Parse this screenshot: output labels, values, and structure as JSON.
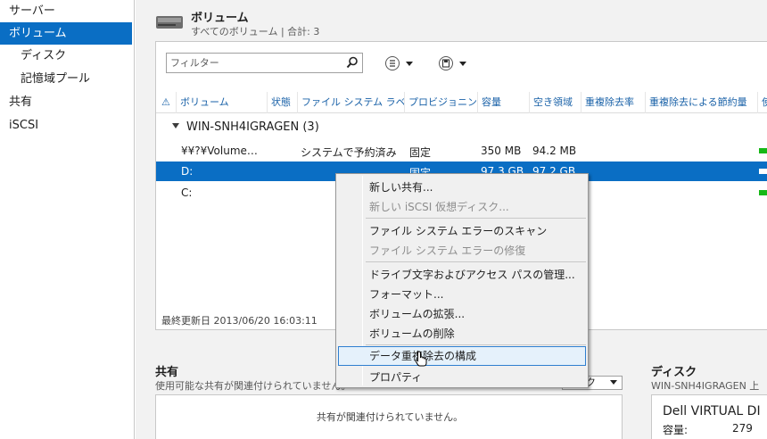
{
  "sidebar": {
    "items": [
      {
        "label": "サーバー"
      },
      {
        "label": "ボリューム"
      },
      {
        "label": "ディスク"
      },
      {
        "label": "記憶域プール"
      },
      {
        "label": "共有"
      },
      {
        "label": "iSCSI"
      }
    ]
  },
  "volumes": {
    "title": "ボリューム",
    "subtitle": "すべてのボリューム | 合計: 3",
    "filter_placeholder": "フィルター",
    "columns": [
      "ボリューム",
      "状態",
      "ファイル システム ラベル",
      "プロビジョニング",
      "容量",
      "空き領域",
      "重複除去率",
      "重複除去による節約量",
      "使"
    ],
    "group": "WIN-SNH4IGRAGEN (3)",
    "rows": [
      {
        "volume": "¥¥?¥Volume…",
        "label": "システムで予約済み",
        "provisioning": "固定",
        "capacity": "350 MB",
        "free": "94.2 MB"
      },
      {
        "volume": "D:",
        "label": "",
        "provisioning": "固定",
        "capacity": "97.3 GB",
        "free": "97.2 GB"
      },
      {
        "volume": "C:",
        "label": "",
        "provisioning": "",
        "capacity": "",
        "free": ""
      }
    ],
    "last_updated": "最終更新日 2013/06/20 16:03:11"
  },
  "shares": {
    "title": "共有",
    "subtitle": "使用可能な共有が関連付けられていません。",
    "tasks_label": "タスク",
    "empty_text": "共有が関連付けられていません。"
  },
  "disk": {
    "title": "ディスク",
    "subtitle": "WIN-SNH4IGRAGEN 上",
    "name": "Dell VIRTUAL DI",
    "capacity_label": "容量:",
    "capacity_value": "279"
  },
  "context_menu": {
    "items": [
      {
        "label": "新しい共有...",
        "disabled": false
      },
      {
        "label": "新しい iSCSI 仮想ディスク...",
        "disabled": true
      },
      {
        "label": "ファイル システム エラーのスキャン",
        "disabled": false
      },
      {
        "label": "ファイル システム エラーの修復",
        "disabled": true
      },
      {
        "label": "ドライブ文字およびアクセス パスの管理...",
        "disabled": false
      },
      {
        "label": "フォーマット...",
        "disabled": false
      },
      {
        "label": "ボリュームの拡張...",
        "disabled": false
      },
      {
        "label": "ボリュームの削除",
        "disabled": false
      },
      {
        "label": "データ重複除去の構成",
        "disabled": false
      },
      {
        "label": "プロパティ",
        "disabled": false
      }
    ]
  },
  "colors": {
    "accent": "#0a6ec4",
    "link": "#1a62a8",
    "status_green": "#17b817"
  }
}
